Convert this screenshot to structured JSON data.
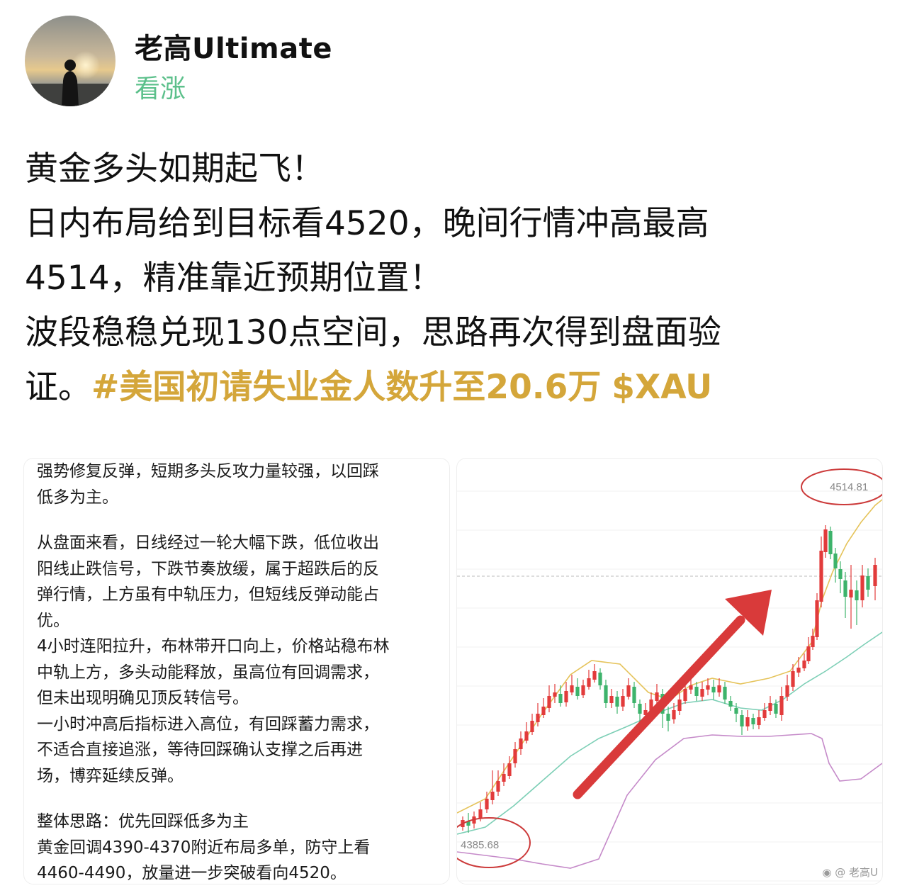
{
  "user": {
    "name": "老高Ultimate",
    "sentiment": "看涨"
  },
  "post": {
    "line1": "黄金多头如期起飞！",
    "line2": "日内布局给到目标看4520，晚间行情冲高最高",
    "line3": "4514，精准靠近预期位置！",
    "line4": "波段稳稳兑现130点空间，思路再次得到盘面验",
    "line5_text": "证。",
    "hashtag": "#美国初请失业金人数升至20.6万",
    "ticker": "$XAU"
  },
  "analysis": {
    "p1": [
      "强势修复反弹，短期多头反攻力量较强，以回踩",
      "低多为主。"
    ],
    "p2": [
      "从盘面来看，日线经过一轮大幅下跌，低位收出",
      "阳线止跌信号，下跌节奏放缓，属于超跌后的反",
      "弹行情，上方虽有中轨压力，但短线反弹动能占",
      "优。",
      "4小时连阳拉升，布林带开口向上，价格站稳布林",
      "中轨上方，多头动能释放，虽高位有回调需求，",
      "但未出现明确见顶反转信号。",
      "一小时冲高后指标进入高位，有回踩蓄力需求，",
      "不适合直接追涨，等待回踩确认支撑之后再进",
      "场，博弈延续反弹。"
    ],
    "p3": [
      "整体思路：优先回踩低多为主",
      "黄金回调4390-4370附近布局多单，防守上看",
      "4460-4490，放量进一步突破看向4520。"
    ]
  },
  "chart": {
    "high_label": "4514.81",
    "low_label": "4385.68",
    "watermark": "老高U",
    "colors": {
      "up": "#e23b3b",
      "down": "#3db36b",
      "upper": "#e5c35a",
      "mid": "#7dcfb6",
      "lower": "#c58ac9",
      "arrow": "#d93a3a"
    }
  },
  "chart_data": {
    "type": "candlestick",
    "annotations": {
      "high": 4514.81,
      "low": 4385.68
    },
    "indicators": [
      "bollinger-upper",
      "bollinger-middle",
      "bollinger-lower"
    ]
  }
}
